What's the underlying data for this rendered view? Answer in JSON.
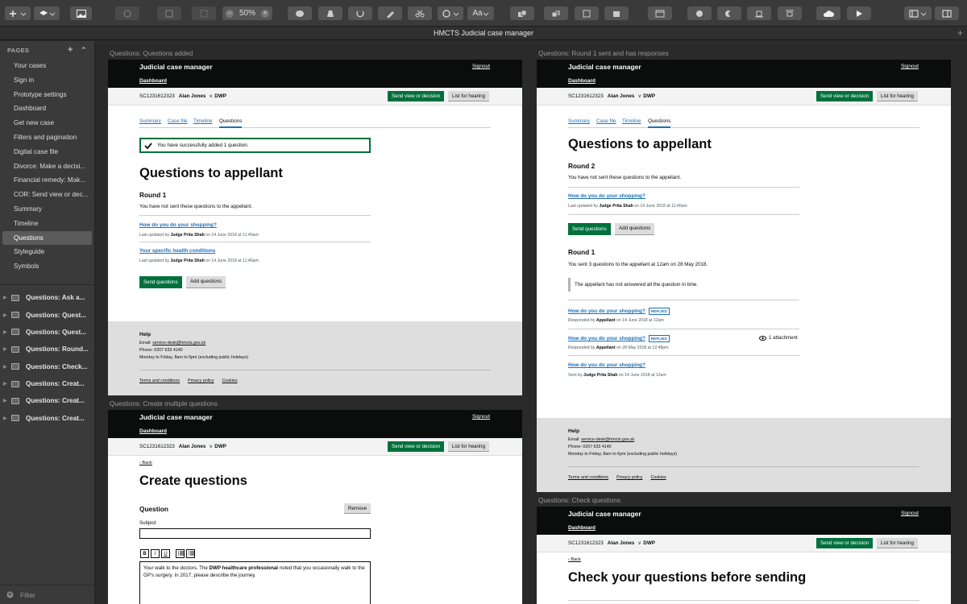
{
  "toolbar": {
    "zoom": "50%",
    "text_button": "Aa"
  },
  "window_title": "HMCTS Judicial case manager",
  "sidebar": {
    "header": "PAGES",
    "pages": [
      "Your cases",
      "Sign in",
      "Prototype settings",
      "Dashboard",
      "Get new case",
      "Filters and pagination",
      "Digital case file",
      "Divorce: Make a decisi...",
      "Financial remedy: Mak...",
      "COR: Send view or dec...",
      "Summary",
      "Timeline",
      "Questions",
      "Styleguide",
      "Symbols"
    ],
    "selected_page": "Questions",
    "artboards": [
      "Questions: Ask a...",
      "Questions: Quest...",
      "Questions: Quest...",
      "Questions: Round...",
      "Questions: Check...",
      "Questions: Creat...",
      "Questions: Creat...",
      "Questions: Creat..."
    ],
    "filter": "Filter"
  },
  "common": {
    "service": "Judicial case manager",
    "signout": "Signout",
    "dashboard": "Dashboard",
    "case_id": "SC1231612323",
    "appellant": "Alan Jones",
    "versus": "v",
    "respondent": "DWP",
    "send_view": "Send view or decision",
    "list_hearing": "List for hearing",
    "tabs": [
      "Summary",
      "Case file",
      "Timeline",
      "Questions"
    ],
    "footer_help": "Help",
    "footer_email_label": "Email:",
    "footer_email": "service-desk@hmcts.gov.uk",
    "footer_phone": "Phone: 0207 633 4140",
    "footer_hours": "Monday to Friday, 8am to 6pm (excluding public holidays)",
    "footer_links": [
      "Terms and conditions",
      "Privacy policy",
      "Cookies"
    ],
    "back": "Back"
  },
  "ab1": {
    "label": "Questions: Questions added",
    "notice": "You have successfully added 1 question.",
    "title": "Questions to appellant",
    "round": "Round 1",
    "round_text": "You have not sent these questions to the appellant.",
    "questions": [
      {
        "title": "How do you do your shopping?",
        "meta_prefix": "Last updated by",
        "who": "Judge Prita Shah",
        "when": "on 14 June 2018 at 11:40am"
      },
      {
        "title": "Your specific health conditions",
        "meta_prefix": "Last updated by",
        "who": "Judge Prita Shah",
        "when": "on 14 June 2018 at 11:40am"
      }
    ],
    "send": "Send questions",
    "add": "Add questions"
  },
  "ab2": {
    "label": "Questions: Round 1 sent and has responses",
    "title": "Questions to appellant",
    "round2": "Round 2",
    "round2_text": "You have not sent these questions to the appellant.",
    "r2_question": {
      "title": "How do you do your shopping?",
      "meta_prefix": "Last updated by",
      "who": "Judge Prita Shah",
      "when": "on 14 June 2018 at 11:40am"
    },
    "send": "Send questions",
    "add": "Add questions",
    "round1": "Round 1",
    "round1_text": "You sent 3 questions to the appellant at 12am on 28 May 2018.",
    "inset": "The appellant has not answered all the question in time.",
    "r1_questions": [
      {
        "title": "How do you do your shopping?",
        "tag": "REPLIED",
        "meta_prefix": "Responded by",
        "who": "Appellant",
        "when": "on 14 June 2018 at 12am"
      },
      {
        "title": "How do you do your shopping?",
        "tag": "REPLIED",
        "meta_prefix": "Responded by",
        "who": "Appellant",
        "when": "on 28 May 2018 at 12:48pm",
        "attachment": "1 attachment"
      },
      {
        "title": "How do you do your shopping?",
        "meta_prefix": "Sent by",
        "who": "Judge Prita Shah",
        "when": "on 14 June 2018 at 12am"
      }
    ]
  },
  "ab3": {
    "label": "Questions: Create multiple questions",
    "title": "Create questions",
    "question_heading": "Question",
    "remove": "Remove",
    "subject_label": "Subject",
    "rte": [
      "B",
      "I",
      "U"
    ],
    "body_pre": "Your walk to the doctors. The ",
    "body_bold": "DWP healthcare professional",
    "body_post": " noted that you occasionally walk to the GP's surgery. In 2017, please describe the journey."
  },
  "ab4": {
    "label": "Questions: Check questions",
    "title": "Check your questions before sending"
  }
}
